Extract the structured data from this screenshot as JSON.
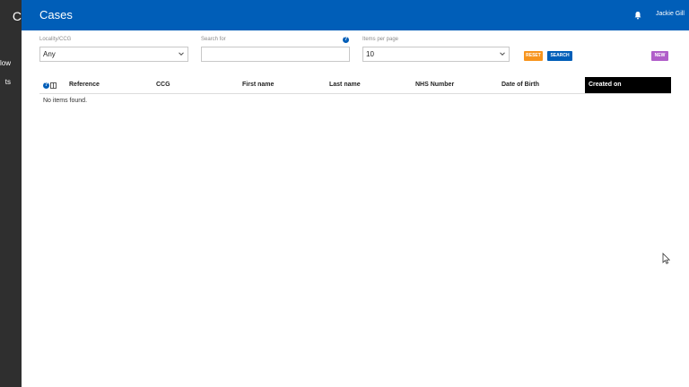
{
  "sidebar": {
    "logo_text": "C",
    "items": [
      {
        "label": "low"
      },
      {
        "label": "ts"
      }
    ]
  },
  "header": {
    "title": "Cases",
    "user_name": "Jackie Gill",
    "bg_color": "#005eb8"
  },
  "filters": {
    "locality": {
      "label": "Locality/CCG",
      "value": "Any"
    },
    "search": {
      "label": "Search for",
      "value": "",
      "placeholder": ""
    },
    "per_page": {
      "label": "Items per page",
      "value": "10"
    },
    "reset_label": "RESET",
    "search_label": "SEARCH",
    "new_label": "NEW",
    "help_glyph": "?"
  },
  "table": {
    "columns": [
      "Reference",
      "CCG",
      "First name",
      "Last name",
      "NHS Number",
      "Date of Birth",
      "Created on"
    ],
    "sorted_column": "Created on",
    "empty_text": "No items found."
  },
  "colors": {
    "reset_button": "#f7941d",
    "search_button": "#005eb8",
    "new_button": "#b05ec9",
    "sidebar": "#2f2f2f"
  }
}
